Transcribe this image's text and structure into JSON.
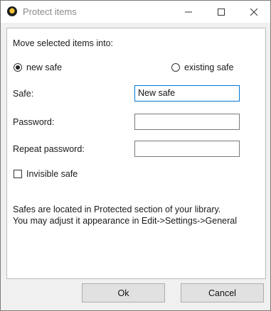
{
  "window": {
    "title": "Protect items"
  },
  "dialog": {
    "heading": "Move selected items into:",
    "destination_options": [
      {
        "label": "new safe",
        "selected": true
      },
      {
        "label": "existing safe",
        "selected": false
      }
    ],
    "safe_label": "Safe:",
    "safe_value": "New safe",
    "password_label": "Password:",
    "password_value": "",
    "repeat_password_label": "Repeat password:",
    "repeat_password_value": "",
    "invisible_label": "Invisible safe",
    "invisible_checked": false,
    "info_line1": "Safes are located in Protected section of your library.",
    "info_line2": "You may adjust it appearance in Edit->Settings->General"
  },
  "buttons": {
    "ok": "Ok",
    "cancel": "Cancel"
  },
  "colors": {
    "focus_border": "#0078d7",
    "window_bg": "#f0f0f0",
    "panel_bg": "#ffffff"
  }
}
